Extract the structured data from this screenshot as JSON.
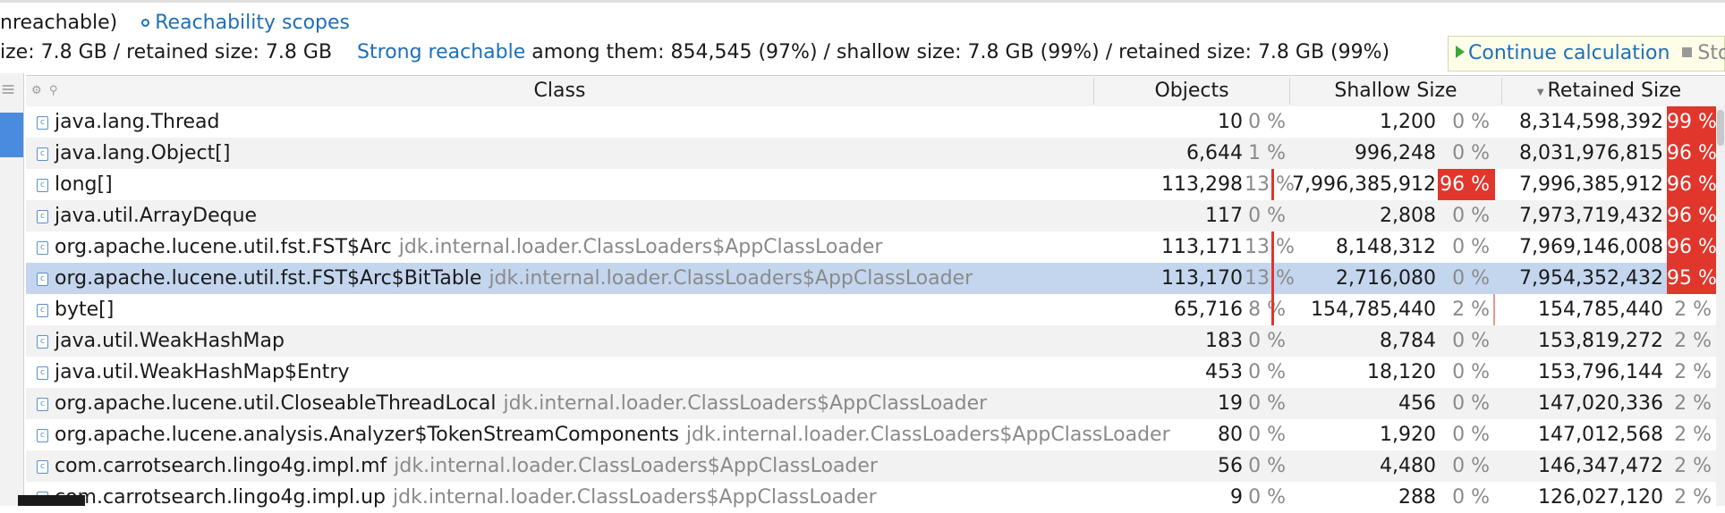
{
  "header": {
    "line1_prefix": "nreachable)",
    "scopes_link": "Reachability scopes",
    "line2_prefix": "ize: 7.8 GB / retained size: 7.8 GB",
    "strong_reachable": "Strong reachable",
    "line2_rest": "among them: 854,545 (97%) / shallow size: 7.8 GB (99%) / retained size: 7.8 GB (99%)"
  },
  "actions": {
    "continue_label": "Continue calculation",
    "stop_label": "Stop"
  },
  "table": {
    "columns": {
      "class": "Class",
      "objects": "Objects",
      "shallow": "Shallow Size",
      "retained": "Retained Size"
    },
    "rows": [
      {
        "name": "java.lang.Thread",
        "loader": "",
        "objects": "10",
        "objects_pct": "0 %",
        "shallow": "1,200",
        "shallow_pct": "0 %",
        "retained": "8,314,598,392",
        "retained_pct": "99 %"
      },
      {
        "name": "java.lang.Object[]",
        "loader": "",
        "objects": "6,644",
        "objects_pct": "1 %",
        "shallow": "996,248",
        "shallow_pct": "0 %",
        "retained": "8,031,976,815",
        "retained_pct": "96 %"
      },
      {
        "name": "long[]",
        "loader": "",
        "objects": "113,298",
        "objects_pct": "13 %",
        "shallow": "7,996,385,912",
        "shallow_pct": "96 %",
        "retained": "7,996,385,912",
        "retained_pct": "96 %"
      },
      {
        "name": "java.util.ArrayDeque",
        "loader": "",
        "objects": "117",
        "objects_pct": "0 %",
        "shallow": "2,808",
        "shallow_pct": "0 %",
        "retained": "7,973,719,432",
        "retained_pct": "96 %"
      },
      {
        "name": "org.apache.lucene.util.fst.FST$Arc",
        "loader": "jdk.internal.loader.ClassLoaders$AppClassLoader",
        "objects": "113,171",
        "objects_pct": "13 %",
        "shallow": "8,148,312",
        "shallow_pct": "0 %",
        "retained": "7,969,146,008",
        "retained_pct": "96 %"
      },
      {
        "name": "org.apache.lucene.util.fst.FST$Arc$BitTable",
        "loader": "jdk.internal.loader.ClassLoaders$AppClassLoader",
        "objects": "113,170",
        "objects_pct": "13 %",
        "shallow": "2,716,080",
        "shallow_pct": "0 %",
        "retained": "7,954,352,432",
        "retained_pct": "95 %"
      },
      {
        "name": "byte[]",
        "loader": "",
        "objects": "65,716",
        "objects_pct": "8 %",
        "shallow": "154,785,440",
        "shallow_pct": "2 %",
        "retained": "154,785,440",
        "retained_pct": "2 %"
      },
      {
        "name": "java.util.WeakHashMap",
        "loader": "",
        "objects": "183",
        "objects_pct": "0 %",
        "shallow": "8,784",
        "shallow_pct": "0 %",
        "retained": "153,819,272",
        "retained_pct": "2 %"
      },
      {
        "name": "java.util.WeakHashMap$Entry",
        "loader": "",
        "objects": "453",
        "objects_pct": "0 %",
        "shallow": "18,120",
        "shallow_pct": "0 %",
        "retained": "153,796,144",
        "retained_pct": "2 %"
      },
      {
        "name": "org.apache.lucene.util.CloseableThreadLocal",
        "loader": "jdk.internal.loader.ClassLoaders$AppClassLoader",
        "objects": "19",
        "objects_pct": "0 %",
        "shallow": "456",
        "shallow_pct": "0 %",
        "retained": "147,020,336",
        "retained_pct": "2 %"
      },
      {
        "name": "org.apache.lucene.analysis.Analyzer$TokenStreamComponents",
        "loader": "jdk.internal.loader.ClassLoaders$AppClassLoader",
        "objects": "80",
        "objects_pct": "0 %",
        "shallow": "1,920",
        "shallow_pct": "0 %",
        "retained": "147,012,568",
        "retained_pct": "2 %"
      },
      {
        "name": "com.carrotsearch.lingo4g.impl.mf",
        "loader": "jdk.internal.loader.ClassLoaders$AppClassLoader",
        "objects": "56",
        "objects_pct": "0 %",
        "shallow": "4,480",
        "shallow_pct": "0 %",
        "retained": "146,347,472",
        "retained_pct": "2 %"
      },
      {
        "name": "com.carrotsearch.lingo4g.impl.up",
        "loader": "jdk.internal.loader.ClassLoaders$AppClassLoader",
        "objects": "9",
        "objects_pct": "0 %",
        "shallow": "288",
        "shallow_pct": "0 %",
        "retained": "126,027,120",
        "retained_pct": "2 %"
      }
    ],
    "selected_row": 5,
    "hot_color": "#e0362c"
  }
}
